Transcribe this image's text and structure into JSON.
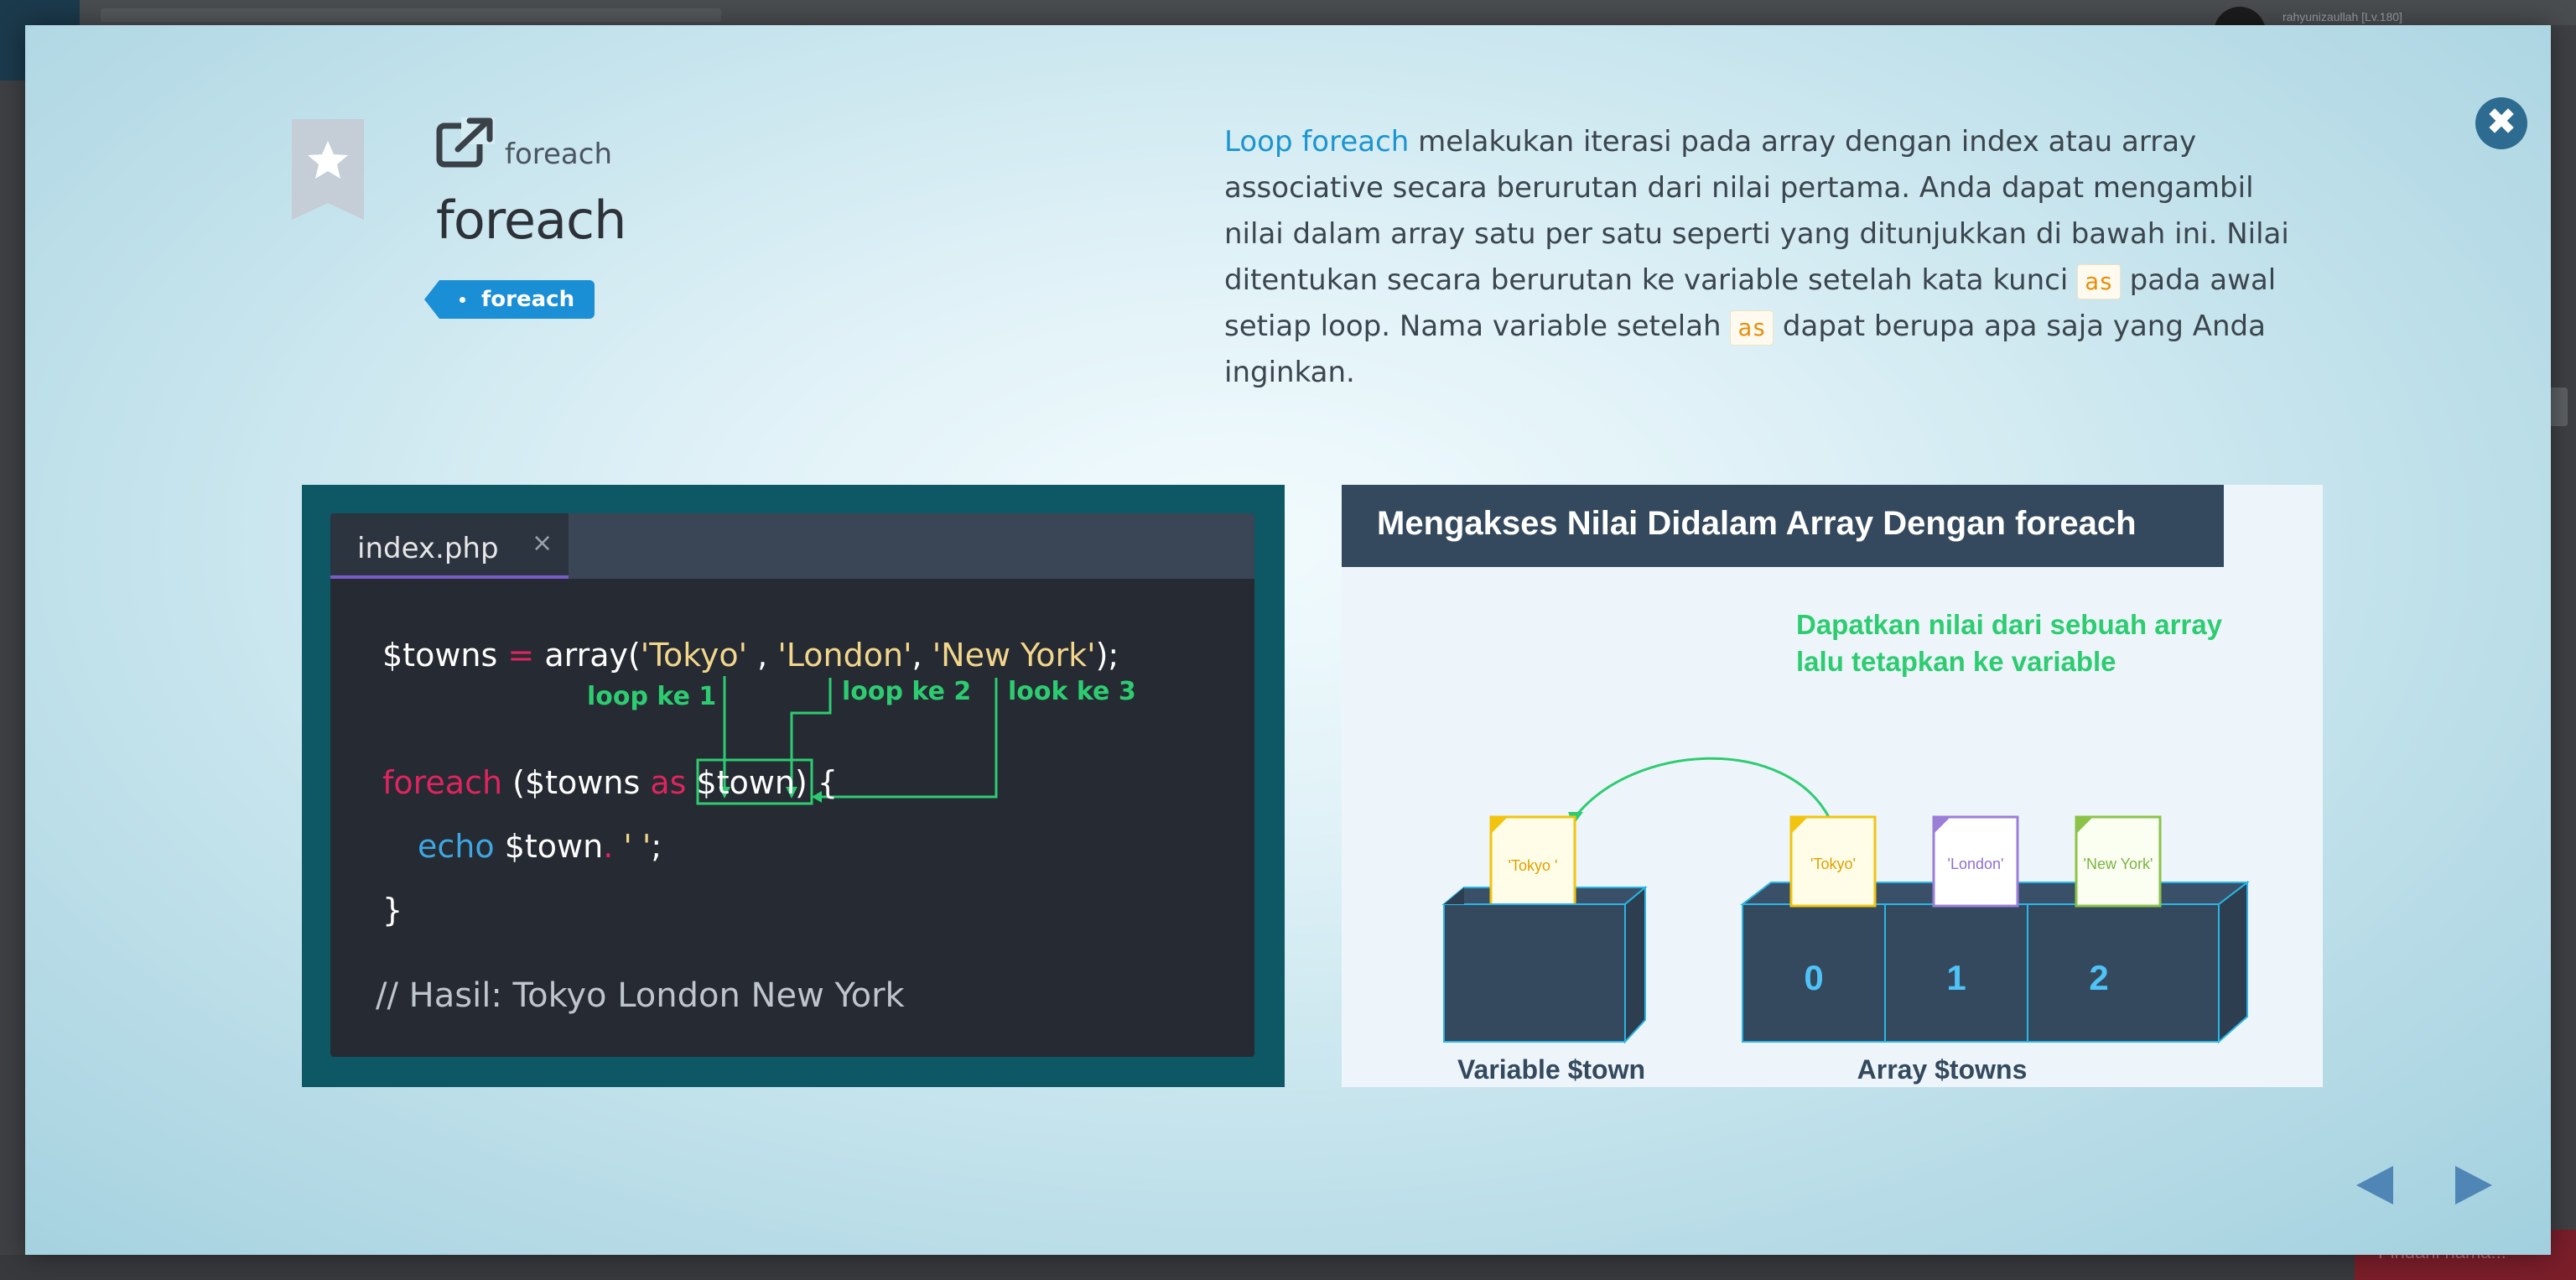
{
  "background": {
    "username": "rahyunizaullah [Lv.180]",
    "bottom_button": "Pindahi hama..."
  },
  "lesson": {
    "subtitle": "foreach",
    "title": "foreach",
    "tag": "foreach",
    "description": {
      "link": "Loop foreach",
      "text1": " melakukan iterasi pada array dengan index atau array associative secara berurutan dari nilai pertama. Anda dapat mengambil nilai dalam array satu per satu seperti yang ditunjukkan di bawah ini. Nilai ditentukan secara berurutan ke variable setelah kata kunci ",
      "code1": "as",
      "text2": " pada awal setiap loop. Nama variable setelah ",
      "code2": "as",
      "text3": " dapat berupa apa saja yang Anda inginkan."
    }
  },
  "code_slide": {
    "tab_name": "index.php",
    "tab_close": "×",
    "line1": {
      "var": "$towns",
      "eq": "=",
      "func": "array(",
      "tokyo": "'Tokyo'",
      "comma1": " , ",
      "london": "'London'",
      "comma2": ", ",
      "newyork": "'New York'",
      "end": ");"
    },
    "labels": [
      "loop ke 1",
      "loop ke 2",
      "look ke 3"
    ],
    "line2": {
      "kw": "foreach",
      "open": " ($towns ",
      "as": "as",
      "var": "$town",
      "close": ") {"
    },
    "line3": {
      "kw": "echo",
      "var": " $town",
      "dot": ".",
      "str": " ' '",
      "semi": ";"
    },
    "line4": "}",
    "comment": "// Hasil: Tokyo London New York"
  },
  "diagram_slide": {
    "title": "Mengakses Nilai Didalam Array Dengan foreach",
    "callout_line1": "Dapatkan nilai dari sebuah array",
    "callout_line2": "lalu tetapkan ke variable",
    "variable_card": "'Tokyo '",
    "array_cards": [
      "'Tokyo'",
      "'London'",
      "'New York'"
    ],
    "indexes": [
      "0",
      "1",
      "2"
    ],
    "variable_label": "Variable $town",
    "array_label": "Array $towns"
  },
  "icons": {
    "close": "close-icon",
    "bookmark": "bookmark-star-icon",
    "external": "external-link-icon",
    "prev": "triangle-left-icon",
    "next": "triangle-right-icon"
  },
  "colors": {
    "accent": "#1a8fd6",
    "code_keyword": "#e0245e",
    "code_string": "#f2d68a",
    "code_green": "#2ecc71",
    "code_blue": "#3498db",
    "diagram_box": "#34495e",
    "diagram_index": "#4fc3f7"
  }
}
